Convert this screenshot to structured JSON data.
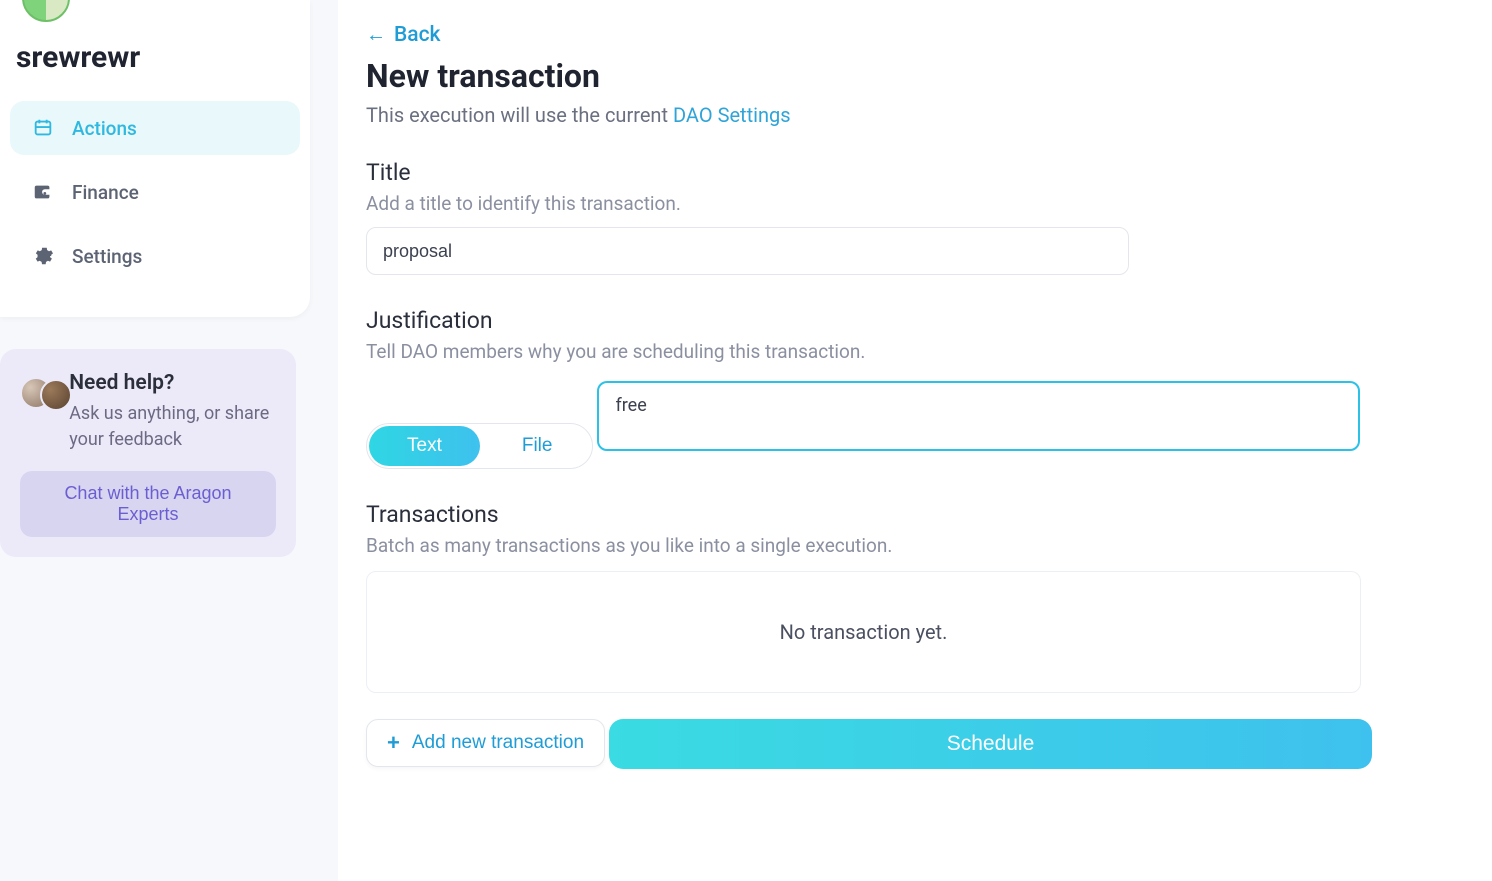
{
  "sidebar": {
    "dao_name": "srewrewr",
    "nav": [
      {
        "label": "Actions",
        "icon": "actions-icon",
        "active": true
      },
      {
        "label": "Finance",
        "icon": "wallet-icon",
        "active": false
      },
      {
        "label": "Settings",
        "icon": "gear-icon",
        "active": false
      }
    ]
  },
  "help": {
    "title": "Need help?",
    "subtitle": "Ask us anything, or share your feedback",
    "button": "Chat with the Aragon Experts"
  },
  "main": {
    "back": "Back",
    "title": "New transaction",
    "subtitle_prefix": "This execution will use the current ",
    "subtitle_link": "DAO Settings",
    "title_section": {
      "heading": "Title",
      "desc": "Add a title to identify this transaction.",
      "value": "proposal"
    },
    "justification": {
      "heading": "Justification",
      "desc": "Tell DAO members why you are scheduling this transaction.",
      "mode_text": "Text",
      "mode_file": "File",
      "value": "free"
    },
    "transactions": {
      "heading": "Transactions",
      "desc": "Batch as many transactions as you like into a single execution.",
      "empty": "No transaction yet.",
      "add_label": "Add new transaction"
    },
    "schedule_label": "Schedule"
  }
}
